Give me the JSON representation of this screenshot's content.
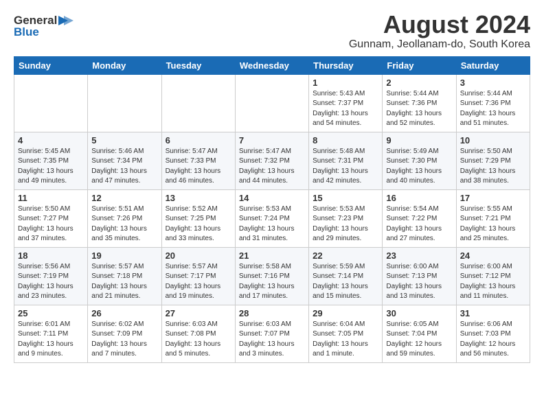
{
  "header": {
    "logo_general": "General",
    "logo_blue": "Blue",
    "main_title": "August 2024",
    "subtitle": "Gunnam, Jeollanam-do, South Korea"
  },
  "weekdays": [
    "Sunday",
    "Monday",
    "Tuesday",
    "Wednesday",
    "Thursday",
    "Friday",
    "Saturday"
  ],
  "weeks": [
    [
      {
        "day": "",
        "info": ""
      },
      {
        "day": "",
        "info": ""
      },
      {
        "day": "",
        "info": ""
      },
      {
        "day": "",
        "info": ""
      },
      {
        "day": "1",
        "info": "Sunrise: 5:43 AM\nSunset: 7:37 PM\nDaylight: 13 hours\nand 54 minutes."
      },
      {
        "day": "2",
        "info": "Sunrise: 5:44 AM\nSunset: 7:36 PM\nDaylight: 13 hours\nand 52 minutes."
      },
      {
        "day": "3",
        "info": "Sunrise: 5:44 AM\nSunset: 7:36 PM\nDaylight: 13 hours\nand 51 minutes."
      }
    ],
    [
      {
        "day": "4",
        "info": "Sunrise: 5:45 AM\nSunset: 7:35 PM\nDaylight: 13 hours\nand 49 minutes."
      },
      {
        "day": "5",
        "info": "Sunrise: 5:46 AM\nSunset: 7:34 PM\nDaylight: 13 hours\nand 47 minutes."
      },
      {
        "day": "6",
        "info": "Sunrise: 5:47 AM\nSunset: 7:33 PM\nDaylight: 13 hours\nand 46 minutes."
      },
      {
        "day": "7",
        "info": "Sunrise: 5:47 AM\nSunset: 7:32 PM\nDaylight: 13 hours\nand 44 minutes."
      },
      {
        "day": "8",
        "info": "Sunrise: 5:48 AM\nSunset: 7:31 PM\nDaylight: 13 hours\nand 42 minutes."
      },
      {
        "day": "9",
        "info": "Sunrise: 5:49 AM\nSunset: 7:30 PM\nDaylight: 13 hours\nand 40 minutes."
      },
      {
        "day": "10",
        "info": "Sunrise: 5:50 AM\nSunset: 7:29 PM\nDaylight: 13 hours\nand 38 minutes."
      }
    ],
    [
      {
        "day": "11",
        "info": "Sunrise: 5:50 AM\nSunset: 7:27 PM\nDaylight: 13 hours\nand 37 minutes."
      },
      {
        "day": "12",
        "info": "Sunrise: 5:51 AM\nSunset: 7:26 PM\nDaylight: 13 hours\nand 35 minutes."
      },
      {
        "day": "13",
        "info": "Sunrise: 5:52 AM\nSunset: 7:25 PM\nDaylight: 13 hours\nand 33 minutes."
      },
      {
        "day": "14",
        "info": "Sunrise: 5:53 AM\nSunset: 7:24 PM\nDaylight: 13 hours\nand 31 minutes."
      },
      {
        "day": "15",
        "info": "Sunrise: 5:53 AM\nSunset: 7:23 PM\nDaylight: 13 hours\nand 29 minutes."
      },
      {
        "day": "16",
        "info": "Sunrise: 5:54 AM\nSunset: 7:22 PM\nDaylight: 13 hours\nand 27 minutes."
      },
      {
        "day": "17",
        "info": "Sunrise: 5:55 AM\nSunset: 7:21 PM\nDaylight: 13 hours\nand 25 minutes."
      }
    ],
    [
      {
        "day": "18",
        "info": "Sunrise: 5:56 AM\nSunset: 7:19 PM\nDaylight: 13 hours\nand 23 minutes."
      },
      {
        "day": "19",
        "info": "Sunrise: 5:57 AM\nSunset: 7:18 PM\nDaylight: 13 hours\nand 21 minutes."
      },
      {
        "day": "20",
        "info": "Sunrise: 5:57 AM\nSunset: 7:17 PM\nDaylight: 13 hours\nand 19 minutes."
      },
      {
        "day": "21",
        "info": "Sunrise: 5:58 AM\nSunset: 7:16 PM\nDaylight: 13 hours\nand 17 minutes."
      },
      {
        "day": "22",
        "info": "Sunrise: 5:59 AM\nSunset: 7:14 PM\nDaylight: 13 hours\nand 15 minutes."
      },
      {
        "day": "23",
        "info": "Sunrise: 6:00 AM\nSunset: 7:13 PM\nDaylight: 13 hours\nand 13 minutes."
      },
      {
        "day": "24",
        "info": "Sunrise: 6:00 AM\nSunset: 7:12 PM\nDaylight: 13 hours\nand 11 minutes."
      }
    ],
    [
      {
        "day": "25",
        "info": "Sunrise: 6:01 AM\nSunset: 7:11 PM\nDaylight: 13 hours\nand 9 minutes."
      },
      {
        "day": "26",
        "info": "Sunrise: 6:02 AM\nSunset: 7:09 PM\nDaylight: 13 hours\nand 7 minutes."
      },
      {
        "day": "27",
        "info": "Sunrise: 6:03 AM\nSunset: 7:08 PM\nDaylight: 13 hours\nand 5 minutes."
      },
      {
        "day": "28",
        "info": "Sunrise: 6:03 AM\nSunset: 7:07 PM\nDaylight: 13 hours\nand 3 minutes."
      },
      {
        "day": "29",
        "info": "Sunrise: 6:04 AM\nSunset: 7:05 PM\nDaylight: 13 hours\nand 1 minute."
      },
      {
        "day": "30",
        "info": "Sunrise: 6:05 AM\nSunset: 7:04 PM\nDaylight: 12 hours\nand 59 minutes."
      },
      {
        "day": "31",
        "info": "Sunrise: 6:06 AM\nSunset: 7:03 PM\nDaylight: 12 hours\nand 56 minutes."
      }
    ]
  ]
}
